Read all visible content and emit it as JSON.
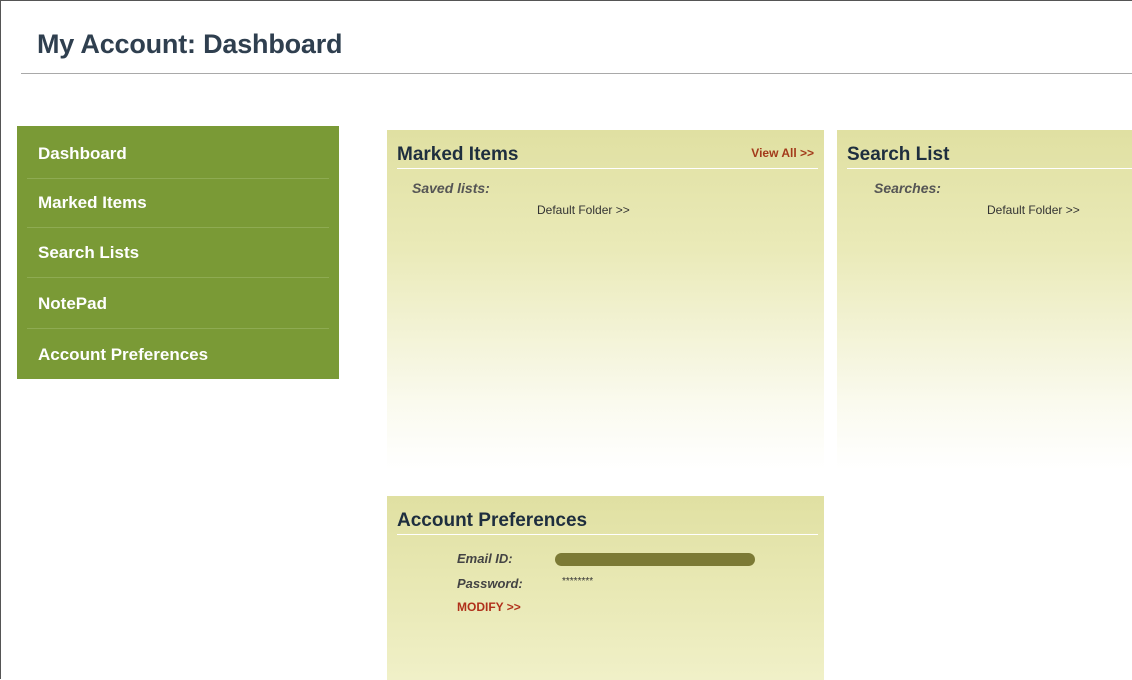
{
  "page": {
    "title": "My Account: Dashboard"
  },
  "sidebar": {
    "items": [
      {
        "label": "Dashboard"
      },
      {
        "label": "Marked Items"
      },
      {
        "label": "Search Lists"
      },
      {
        "label": "NotePad"
      },
      {
        "label": "Account Preferences"
      }
    ]
  },
  "marked_items": {
    "title": "Marked Items",
    "view_all": "View All >>",
    "saved_lists_label": "Saved lists:",
    "default_folder": "Default Folder >>"
  },
  "search_list": {
    "title": "Search List",
    "searches_label": "Searches:",
    "default_folder": "Default Folder >>"
  },
  "account_preferences": {
    "title": "Account Preferences",
    "email_label": "Email ID:",
    "password_label": "Password:",
    "password_value": "********",
    "modify_label": "MODIFY >>"
  },
  "colors": {
    "sidebar_bg": "#7a9a36",
    "panel_bg": "#e0e0a2",
    "link_red": "#a33a1a",
    "title_text": "#2f3f4f"
  }
}
